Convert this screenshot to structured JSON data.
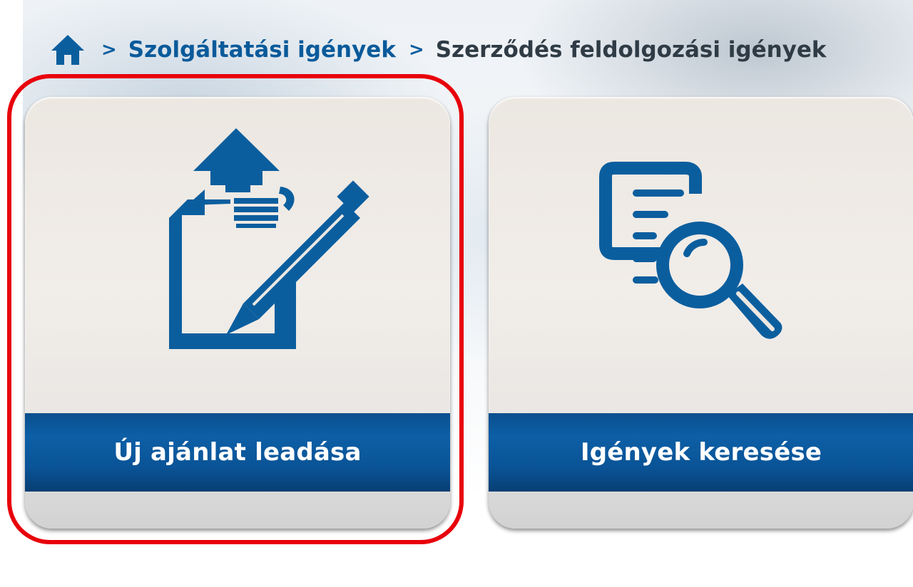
{
  "breadcrumb": {
    "home_icon": "home-icon",
    "separator": ">",
    "items": [
      {
        "label": "Szolgáltatási igények"
      },
      {
        "label": "Szerződés feldolgozási igények"
      }
    ]
  },
  "tiles": [
    {
      "label": "Új ajánlat leadása",
      "icon": "edit-document-upload-icon"
    },
    {
      "label": "Igények keresése",
      "icon": "document-search-icon"
    }
  ],
  "colors": {
    "brand_blue": "#0a5a9a",
    "highlight_red": "#e8000b"
  }
}
